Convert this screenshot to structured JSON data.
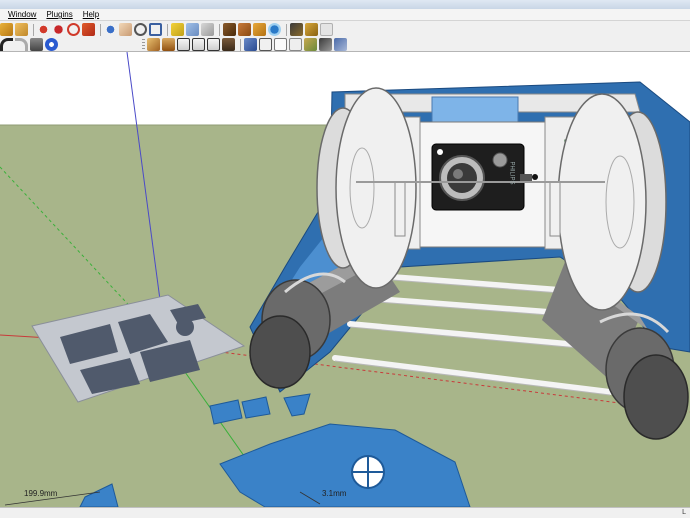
{
  "menu": {
    "items": [
      "Window",
      "Plugins",
      "Help"
    ]
  },
  "toolbar": {
    "row1_icons": [
      "select-icon",
      "paint-bucket-icon",
      "move-icon",
      "push-pull-icon",
      "rotate-icon",
      "follow-me-icon",
      "orbit-icon",
      "pan-icon",
      "zoom-icon",
      "zoom-extents-icon",
      "tape-measure-icon",
      "protractor-icon",
      "text-icon",
      "dimension-icon",
      "axes-icon",
      "section-plane-icon",
      "3d-warehouse-icon",
      "component-icon",
      "extension-icon"
    ],
    "row2_icons": [
      "undo-icon",
      "redo-icon",
      "print-icon",
      "model-info-icon",
      "iso-view-icon",
      "top-view-icon",
      "front-view-icon",
      "right-view-icon",
      "back-view-icon",
      "left-view-icon",
      "xray-icon",
      "wireframe-icon",
      "hidden-line-icon",
      "shaded-icon",
      "shaded-textures-icon",
      "monochrome-icon"
    ]
  },
  "viewport": {
    "dimension_left": "199.9mm",
    "dimension_right": "3.1mm",
    "camera_brand": "PHILIPS"
  },
  "colors": {
    "sky": "#ffffff",
    "ground": "#a8b58a",
    "frame_blue": "#3a82c8",
    "plate_gray": "#5b6b82"
  },
  "status": {
    "right_text": "L"
  }
}
